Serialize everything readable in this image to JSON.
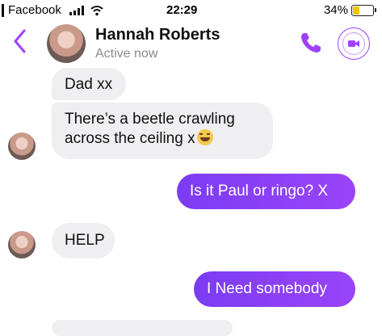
{
  "status_bar": {
    "carrier": "Facebook",
    "time": "22:29",
    "battery_percent": "34%",
    "battery_level": 0.34
  },
  "header": {
    "contact_name": "Hannah Roberts",
    "contact_status": "Active now",
    "accent_color": "#a040ff"
  },
  "messages": [
    {
      "from": "contact",
      "text": "Dad xx"
    },
    {
      "from": "contact",
      "line1": "There’s a beetle crawling",
      "line2": "across the ceiling x",
      "emoji": "rofl-emoji"
    },
    {
      "from": "me",
      "text": "Is it Paul or ringo? X"
    },
    {
      "from": "contact",
      "text": "HELP"
    },
    {
      "from": "me",
      "text": "I Need somebody"
    }
  ],
  "colors": {
    "incoming_bubble": "#efeff1",
    "outgoing_bubble": "#8a3ff7"
  }
}
